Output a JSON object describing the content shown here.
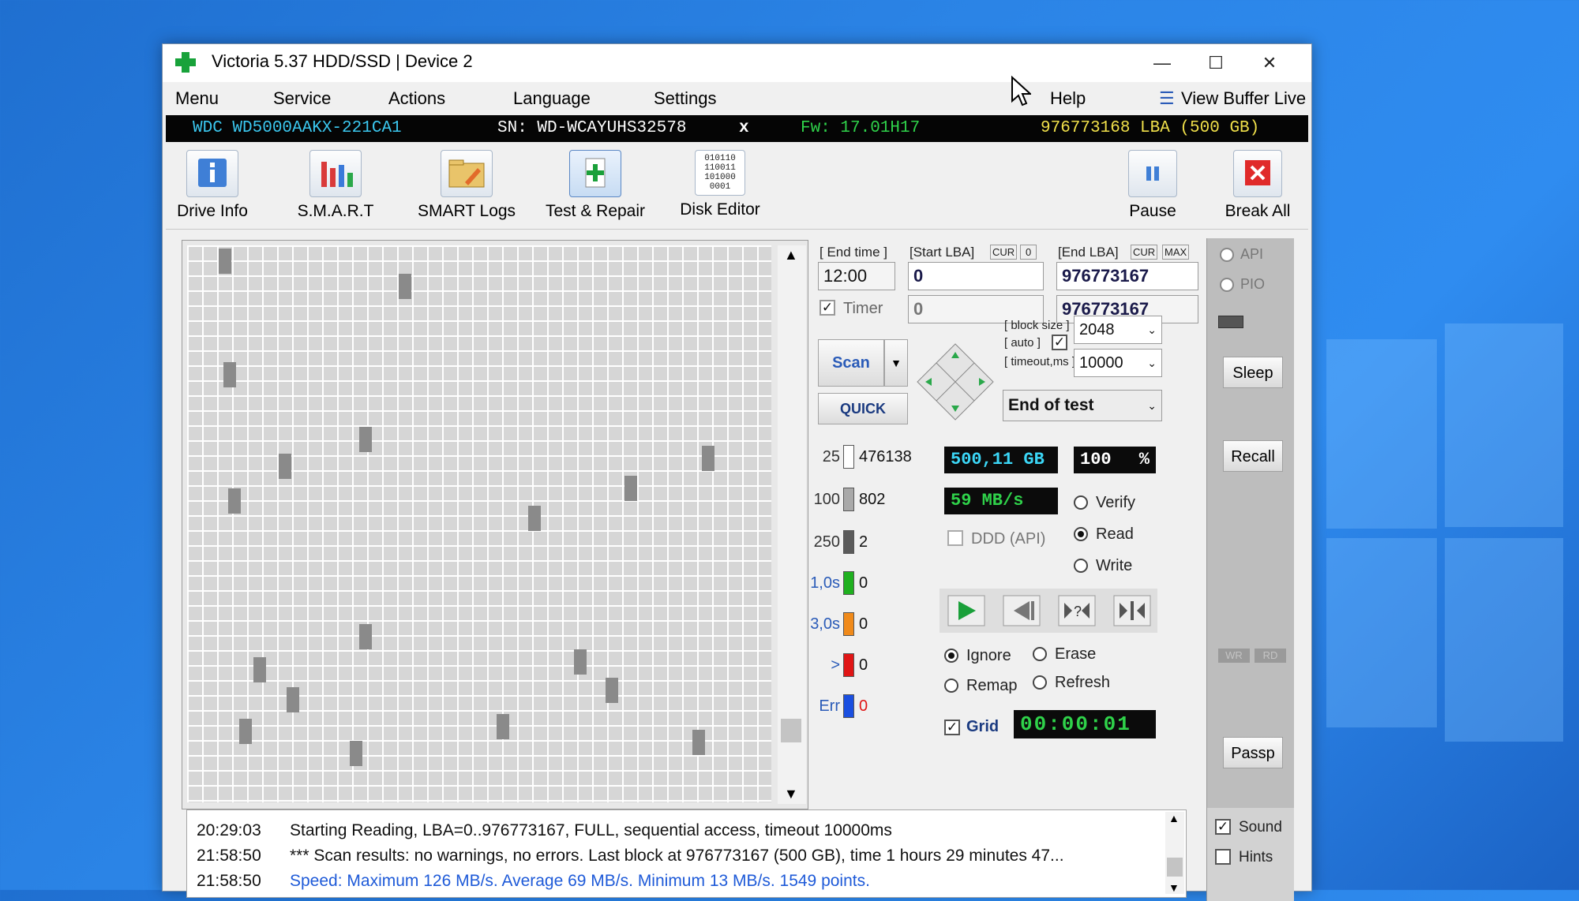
{
  "window": {
    "title": "Victoria 5.37 HDD/SSD | Device 2"
  },
  "menu": [
    "Menu",
    "Service",
    "Actions",
    "Language",
    "Settings",
    "Help",
    "View Buffer Live"
  ],
  "device": {
    "model": "WDC WD5000AAKX-221CA1",
    "serial": "SN: WD-WCAYUHS32578",
    "close": "x",
    "firmware": "Fw: 17.01H17",
    "capacity": "976773168 LBA (500 GB)"
  },
  "toolbar": {
    "drive_info": "Drive Info",
    "smart": "S.M.A.R.T",
    "smart_logs": "SMART Logs",
    "test_repair": "Test & Repair",
    "disk_editor": "Disk Editor",
    "pause": "Pause",
    "break_all": "Break All",
    "disk_editor_glyph": "010110 110011 101000 0001"
  },
  "scan": {
    "end_time_label": "[ End time ]",
    "end_time": "12:00",
    "start_lba_label": "[Start LBA]",
    "cur": "CUR",
    "zero": "0",
    "end_lba_label": "[End LBA]",
    "max": "MAX",
    "start_lba": "0",
    "end_lba": "976773167",
    "timer_label": "Timer",
    "timer_value": "0",
    "timer_end": "976773167",
    "scan_label": "Scan",
    "quick_label": "QUICK",
    "block_size_label": "[ block size ]",
    "auto_label": "[ auto ]",
    "block_size": "2048",
    "timeout_label": "[ timeout,ms ]",
    "timeout": "10000",
    "end_action": "End of test",
    "size": "500,11 GB",
    "percent": "100",
    "percent_sign": "%",
    "speed": "59 MB/s",
    "ddd_label": "DDD (API)",
    "verify": "Verify",
    "read": "Read",
    "write": "Write",
    "ignore": "Ignore",
    "erase": "Erase",
    "remap": "Remap",
    "refresh": "Refresh",
    "grid_label": "Grid",
    "elapsed": "00:00:01"
  },
  "legend": [
    {
      "label": "25",
      "count": "476138",
      "color": "#ffffff"
    },
    {
      "label": "100",
      "count": "802",
      "color": "#a9a9a9"
    },
    {
      "label": "250",
      "count": "2",
      "color": "#5a5a5a"
    },
    {
      "label": "1,0s",
      "count": "0",
      "color": "#1fb01f"
    },
    {
      "label": "3,0s",
      "count": "0",
      "color": "#f08a1a"
    },
    {
      "label": ">",
      "count": "0",
      "color": "#e01515"
    },
    {
      "label": "Err",
      "count": "0",
      "color": "#1a4fe0"
    }
  ],
  "side": {
    "api": "API",
    "pio": "PIO",
    "sleep": "Sleep",
    "recall": "Recall",
    "wr": "WR",
    "rd": "RD",
    "passp": "Passp",
    "sound": "Sound",
    "hints": "Hints"
  },
  "log": [
    {
      "time": "20:29:03",
      "text": "Starting Reading, LBA=0..976773167, FULL, sequential access, timeout 10000ms",
      "color": "#111111"
    },
    {
      "time": "21:58:50",
      "text": "*** Scan results: no warnings, no errors. Last block at 976773167 (500 GB), time 1 hours 29 minutes 47...",
      "color": "#111111"
    },
    {
      "time": "21:58:50",
      "text": "Speed: Maximum 126 MB/s. Average 69 MB/s. Minimum 13 MB/s. 1549 points.",
      "color": "#1e5ad8"
    }
  ]
}
